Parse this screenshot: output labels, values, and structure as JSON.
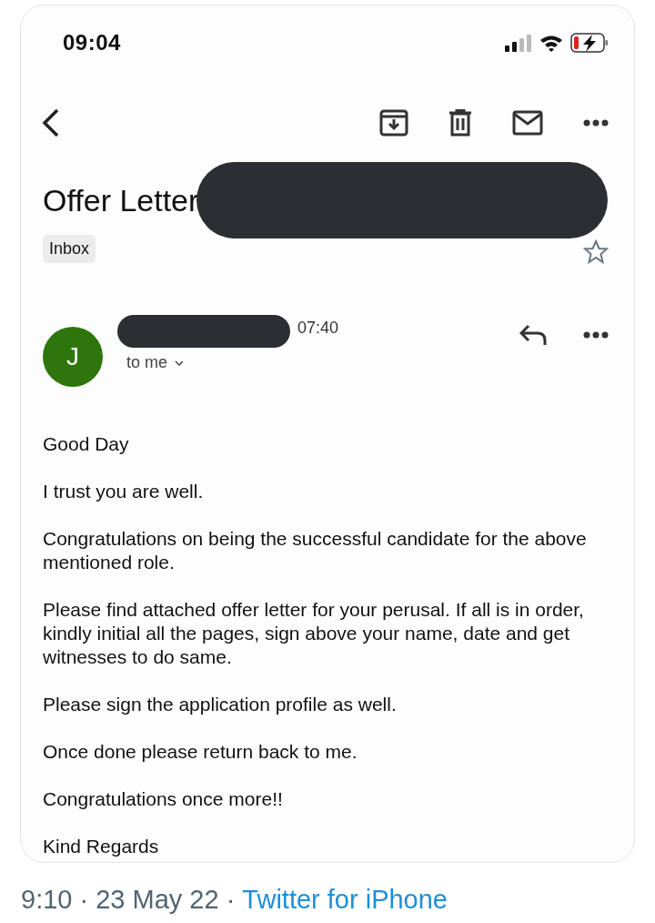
{
  "status_bar": {
    "time": "09:04"
  },
  "email": {
    "subject": "Offer Letter",
    "label": "Inbox",
    "starred": false,
    "sender": {
      "initial": "J",
      "color": "#2e760b",
      "time": "07:40",
      "recipient": "to me"
    },
    "paragraphs": [
      "Good Day",
      "I trust you are well.",
      "Congratulations on being the successful candidate for the above mentioned role.",
      "Please find attached offer letter for your perusal. If all is in order, kindly initial all the pages, sign above your name, date and get witnesses to do same.",
      "Please sign the application profile as well.",
      "Once done please return back to me.",
      "Congratulations once more!!",
      "Kind Regards"
    ]
  },
  "tweet_footer": {
    "timestamp": "9:10 · 23 May 22 ·",
    "source": "Twitter for iPhone"
  }
}
